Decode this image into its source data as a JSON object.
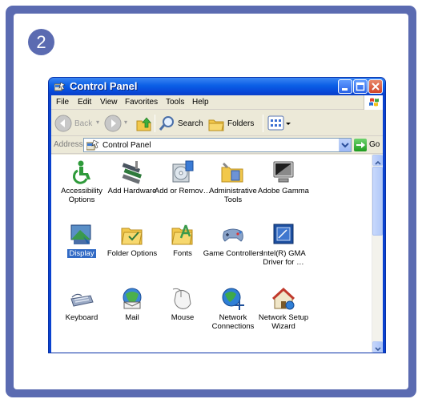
{
  "step_number": "2",
  "window": {
    "title": "Control Panel",
    "menu": [
      "File",
      "Edit",
      "View",
      "Favorites",
      "Tools",
      "Help"
    ],
    "toolbar": {
      "back_label": "Back",
      "search_label": "Search",
      "folders_label": "Folders"
    },
    "address": {
      "label": "Address",
      "value": "Control Panel",
      "go_label": "Go"
    },
    "selected_item": "Display",
    "items": [
      {
        "label": "Accessibility Options",
        "icon": "accessibility-icon"
      },
      {
        "label": "Add Hardware",
        "icon": "add-hardware-icon"
      },
      {
        "label": "Add or Remov…",
        "icon": "add-remove-programs-icon"
      },
      {
        "label": "Administrative Tools",
        "icon": "administrative-tools-icon"
      },
      {
        "label": "Adobe Gamma",
        "icon": "adobe-gamma-icon"
      },
      {
        "label": "Display",
        "icon": "display-icon"
      },
      {
        "label": "Folder Options",
        "icon": "folder-options-icon"
      },
      {
        "label": "Fonts",
        "icon": "fonts-icon"
      },
      {
        "label": "Game Controllers",
        "icon": "game-controllers-icon"
      },
      {
        "label": "Intel(R) GMA Driver for …",
        "icon": "intel-gma-icon"
      },
      {
        "label": "Keyboard",
        "icon": "keyboard-icon"
      },
      {
        "label": "Mail",
        "icon": "mail-icon"
      },
      {
        "label": "Mouse",
        "icon": "mouse-icon"
      },
      {
        "label": "Network Connections",
        "icon": "network-connections-icon"
      },
      {
        "label": "Network Setup Wizard",
        "icon": "network-setup-wizard-icon"
      }
    ]
  },
  "colors": {
    "frame": "#5b6bb1",
    "titlebar": "#0a5fe6",
    "selection": "#316ac5"
  }
}
